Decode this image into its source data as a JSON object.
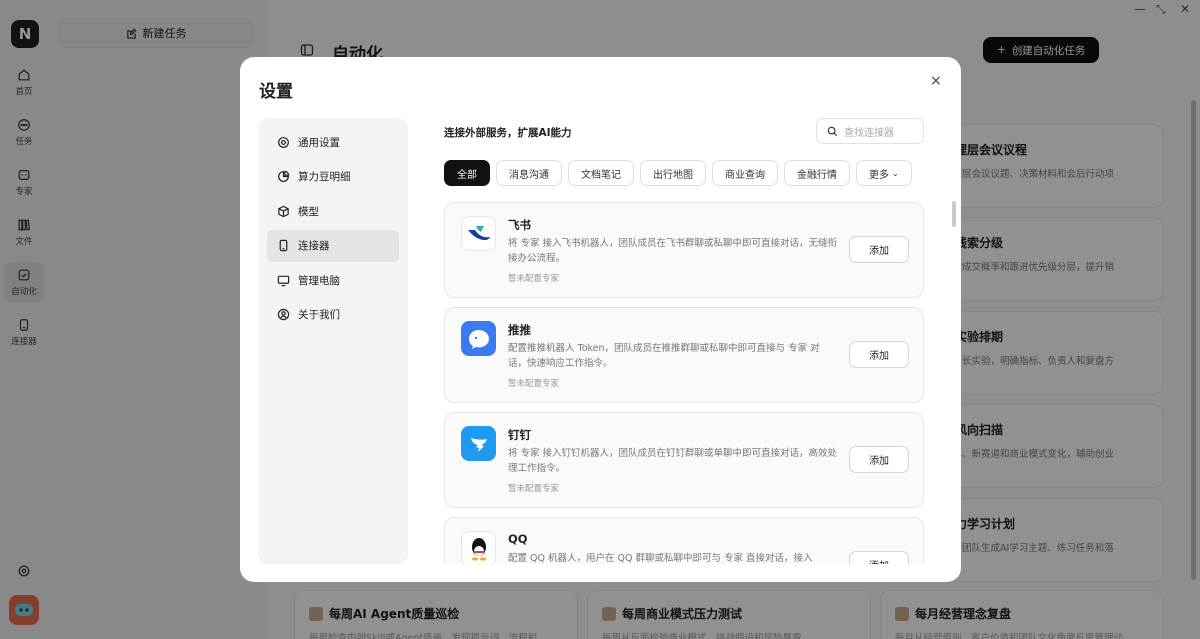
{
  "rail": {
    "logo": "N",
    "items": [
      {
        "label": "首页",
        "icon": "home-icon"
      },
      {
        "label": "任务",
        "icon": "chat-icon"
      },
      {
        "label": "专家",
        "icon": "bot-icon"
      },
      {
        "label": "文件",
        "icon": "files-icon"
      },
      {
        "label": "自动化",
        "icon": "automation-icon"
      },
      {
        "label": "连接器",
        "icon": "connector-icon"
      }
    ]
  },
  "tasks": {
    "new_task_label": "新建任务"
  },
  "main": {
    "title": "自动化",
    "create_label": "创建自动化任务",
    "right_cards": [
      {
        "title": "管理层会议议程",
        "desc": "管理层会议议题、决策材料和会后行动项"
      },
      {
        "title": "售线索分级",
        "desc": "户按成交概率和跟进优先级分层，提升销"
      },
      {
        "title": "长实验排期",
        "desc": "本增长实验，明确指标、负责人和复盘方"
      },
      {
        "title": "段风向扫描",
        "desc": "事件、新赛道和商业模式变化，辅助创业"
      },
      {
        "title": "能力学习计划",
        "desc": "骨干团队生成AI学习主题、练习任务和落"
      }
    ],
    "bottom_cards": [
      {
        "title": "每周AI Agent质量巡检",
        "desc": "每周检查内部Skill或Agent质量，发现提示词、流程和"
      },
      {
        "title": "每周商业模式压力测试",
        "desc": "每周从反面检验商业模式，挑战假设和风险暴露"
      },
      {
        "title": "每月经营理念复盘",
        "desc": "每月从经营原则、客户价值和团队文化角度反思管理动"
      }
    ]
  },
  "modal": {
    "title": "设置",
    "close": "×",
    "nav": [
      {
        "label": "通用设置",
        "icon": "settings-icon"
      },
      {
        "label": "算力豆明细",
        "icon": "pie-chart-icon"
      },
      {
        "label": "模型",
        "icon": "cube-icon"
      },
      {
        "label": "连接器",
        "icon": "phone-icon"
      },
      {
        "label": "管理电脑",
        "icon": "monitor-icon"
      },
      {
        "label": "关于我们",
        "icon": "user-circle-icon"
      }
    ],
    "active_nav": "连接器",
    "heading": "连接外部服务，扩展AI能力",
    "search_placeholder": "查找连接器",
    "filters": [
      "全部",
      "消息沟通",
      "文档笔记",
      "出行地图",
      "商业查询",
      "金融行情",
      "更多"
    ],
    "connectors": [
      {
        "name": "飞书",
        "desc": "将 专家 接入飞书机器人，团队成员在飞书群聊或私聊中即可直接对话，无缝衔接办公流程。",
        "status": "暂未配置专家",
        "add": "添加",
        "icon": "feishu-icon",
        "color": "#2cb5a8"
      },
      {
        "name": "推推",
        "desc": "配置推推机器人 Token，团队成员在推推群聊或私聊中即可直接与 专家 对话，快速响应工作指令。",
        "status": "暂未配置专家",
        "add": "添加",
        "icon": "tuitui-icon",
        "color": "#3a7bf2"
      },
      {
        "name": "钉钉",
        "desc": "将 专家 接入钉钉机器人，团队成员在钉钉群聊或单聊中即可直接对话，高效处理工作指令。",
        "status": "暂未配置专家",
        "add": "添加",
        "icon": "dingtalk-icon",
        "color": "#1e9bf0"
      },
      {
        "name": "QQ",
        "desc": "配置 QQ 机器人，用户在 QQ 群聊或私聊中即可与 专家 直接对话，接入",
        "status": "",
        "add": "添加",
        "icon": "qq-icon",
        "color": "#111111"
      }
    ]
  }
}
